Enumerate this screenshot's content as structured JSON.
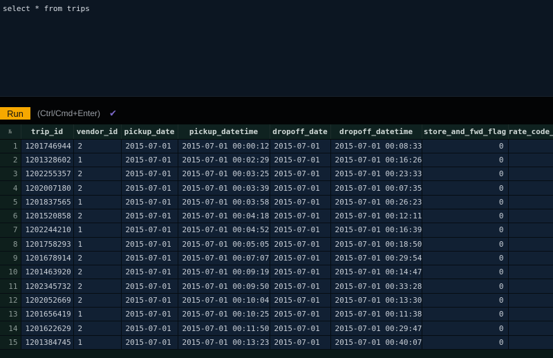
{
  "editor": {
    "query": "select * from trips"
  },
  "toolbar": {
    "run_label": "Run",
    "hint": "(Ctrl/Cmd+Enter)",
    "status_icon": "checkmark-icon"
  },
  "table": {
    "rownum_header": "№",
    "columns": [
      "trip_id",
      "vendor_id",
      "pickup_date",
      "pickup_datetime",
      "dropoff_date",
      "dropoff_datetime",
      "store_and_fwd_flag",
      "rate_code_"
    ],
    "rows": [
      [
        "1",
        "1201746944",
        "2",
        "2015-07-01",
        "2015-07-01 00:00:12",
        "2015-07-01",
        "2015-07-01 00:08:33",
        "0",
        ""
      ],
      [
        "2",
        "1201328602",
        "1",
        "2015-07-01",
        "2015-07-01 00:02:29",
        "2015-07-01",
        "2015-07-01 00:16:26",
        "0",
        ""
      ],
      [
        "3",
        "1202255357",
        "2",
        "2015-07-01",
        "2015-07-01 00:03:25",
        "2015-07-01",
        "2015-07-01 00:23:33",
        "0",
        ""
      ],
      [
        "4",
        "1202007180",
        "2",
        "2015-07-01",
        "2015-07-01 00:03:39",
        "2015-07-01",
        "2015-07-01 00:07:35",
        "0",
        ""
      ],
      [
        "5",
        "1201837565",
        "1",
        "2015-07-01",
        "2015-07-01 00:03:58",
        "2015-07-01",
        "2015-07-01 00:26:23",
        "0",
        ""
      ],
      [
        "6",
        "1201520858",
        "2",
        "2015-07-01",
        "2015-07-01 00:04:18",
        "2015-07-01",
        "2015-07-01 00:12:11",
        "0",
        ""
      ],
      [
        "7",
        "1202244210",
        "1",
        "2015-07-01",
        "2015-07-01 00:04:52",
        "2015-07-01",
        "2015-07-01 00:16:39",
        "0",
        ""
      ],
      [
        "8",
        "1201758293",
        "1",
        "2015-07-01",
        "2015-07-01 00:05:05",
        "2015-07-01",
        "2015-07-01 00:18:50",
        "0",
        ""
      ],
      [
        "9",
        "1201678914",
        "2",
        "2015-07-01",
        "2015-07-01 00:07:07",
        "2015-07-01",
        "2015-07-01 00:29:54",
        "0",
        ""
      ],
      [
        "10",
        "1201463920",
        "2",
        "2015-07-01",
        "2015-07-01 00:09:19",
        "2015-07-01",
        "2015-07-01 00:14:47",
        "0",
        ""
      ],
      [
        "11",
        "1202345732",
        "2",
        "2015-07-01",
        "2015-07-01 00:09:50",
        "2015-07-01",
        "2015-07-01 00:33:28",
        "0",
        ""
      ],
      [
        "12",
        "1202052669",
        "2",
        "2015-07-01",
        "2015-07-01 00:10:04",
        "2015-07-01",
        "2015-07-01 00:13:30",
        "0",
        ""
      ],
      [
        "13",
        "1201656419",
        "1",
        "2015-07-01",
        "2015-07-01 00:10:25",
        "2015-07-01",
        "2015-07-01 00:11:38",
        "0",
        ""
      ],
      [
        "14",
        "1201622629",
        "2",
        "2015-07-01",
        "2015-07-01 00:11:50",
        "2015-07-01",
        "2015-07-01 00:29:47",
        "0",
        ""
      ],
      [
        "15",
        "1201384745",
        "1",
        "2015-07-01",
        "2015-07-01 00:13:23",
        "2015-07-01",
        "2015-07-01 00:40:07",
        "0",
        ""
      ]
    ]
  }
}
